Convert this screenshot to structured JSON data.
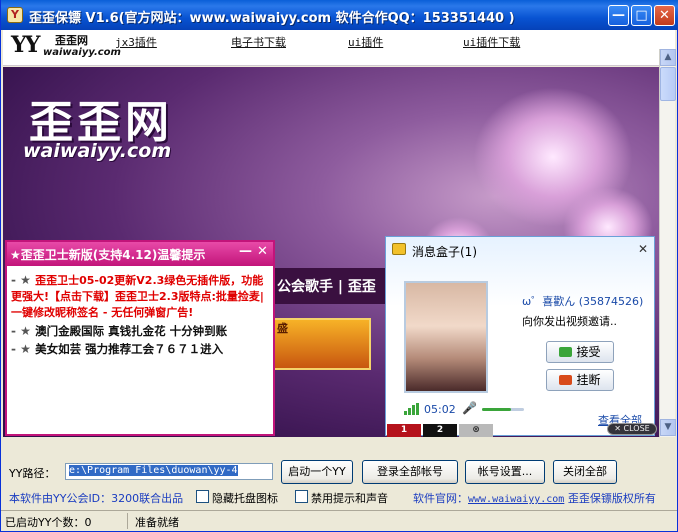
{
  "window": {
    "title": "歪歪保镖 V1.6(官方网站：www.waiwaiyy.com 软件合作QQ：153351440 )",
    "min_glyph": "—",
    "max_glyph": "□",
    "close_glyph": "✕"
  },
  "nav": {
    "logo_yy": "YY",
    "logo_cn": "歪歪网",
    "logo_en": "waiwaiyy.com",
    "links": [
      "jx3插件",
      "电子书下载",
      "ui插件",
      "ui插件下载"
    ]
  },
  "site": {
    "logo_cn": "歪歪网",
    "logo_en": "waiwaiyy.com",
    "banner_text": "公会歌手 | 歪歪",
    "tile_text": "盛"
  },
  "notice": {
    "title": "★歪歪卫士新版(支持4.12)温馨提示",
    "min_glyph": "—",
    "close_glyph": "✕",
    "red_text": "歪歪卫士05-02更新V2.3绿色无插件版，功能更强大!【点击下载】歪歪卫士2.3版特点:批量捡麦|一键修改昵称签名 - 无任何弹窗广告!",
    "line1": "澳门金殿国际 真钱扎金花 十分钟到账",
    "line2": "美女如芸 强力推荐工会７６７１进入"
  },
  "msgbox": {
    "title": "消息盒子(1)",
    "close_glyph": "✕",
    "sender": "ω゜喜歡ん  (35874526)",
    "text": "向你发出视频邀请..",
    "accept": "接受",
    "hangup": "挂断",
    "time": "05:02",
    "volume": 0.7,
    "view_all": "查看全部"
  },
  "overlay": {
    "close_pill": "✕ CLOSE",
    "pages": [
      "1",
      "2",
      "⊗"
    ]
  },
  "controls": {
    "path_label": "YY路径：",
    "path_value": "e:\\Program Files\\duowan\\yy-4",
    "start_one": "启动一个YY",
    "login_all": "登录全部帐号",
    "account_settings": "帐号设置...",
    "close_all": "关闭全部",
    "credit": "本软件由YY公会ID：3200联合出品",
    "hide_tray": "隐藏托盘图标",
    "disable_tips": "禁用提示和声音",
    "official_site_label": "软件官网：",
    "official_site_url": "www.waiwaiyy.com",
    "copyright": "歪歪保镖版权所有"
  },
  "statusbar": {
    "count": "已启动YY个数：0",
    "state": "准备就绪"
  },
  "colors": {
    "titlebar": "#0853d2",
    "notice_accent": "#c2147a",
    "link_blue": "#1a3cc0"
  }
}
